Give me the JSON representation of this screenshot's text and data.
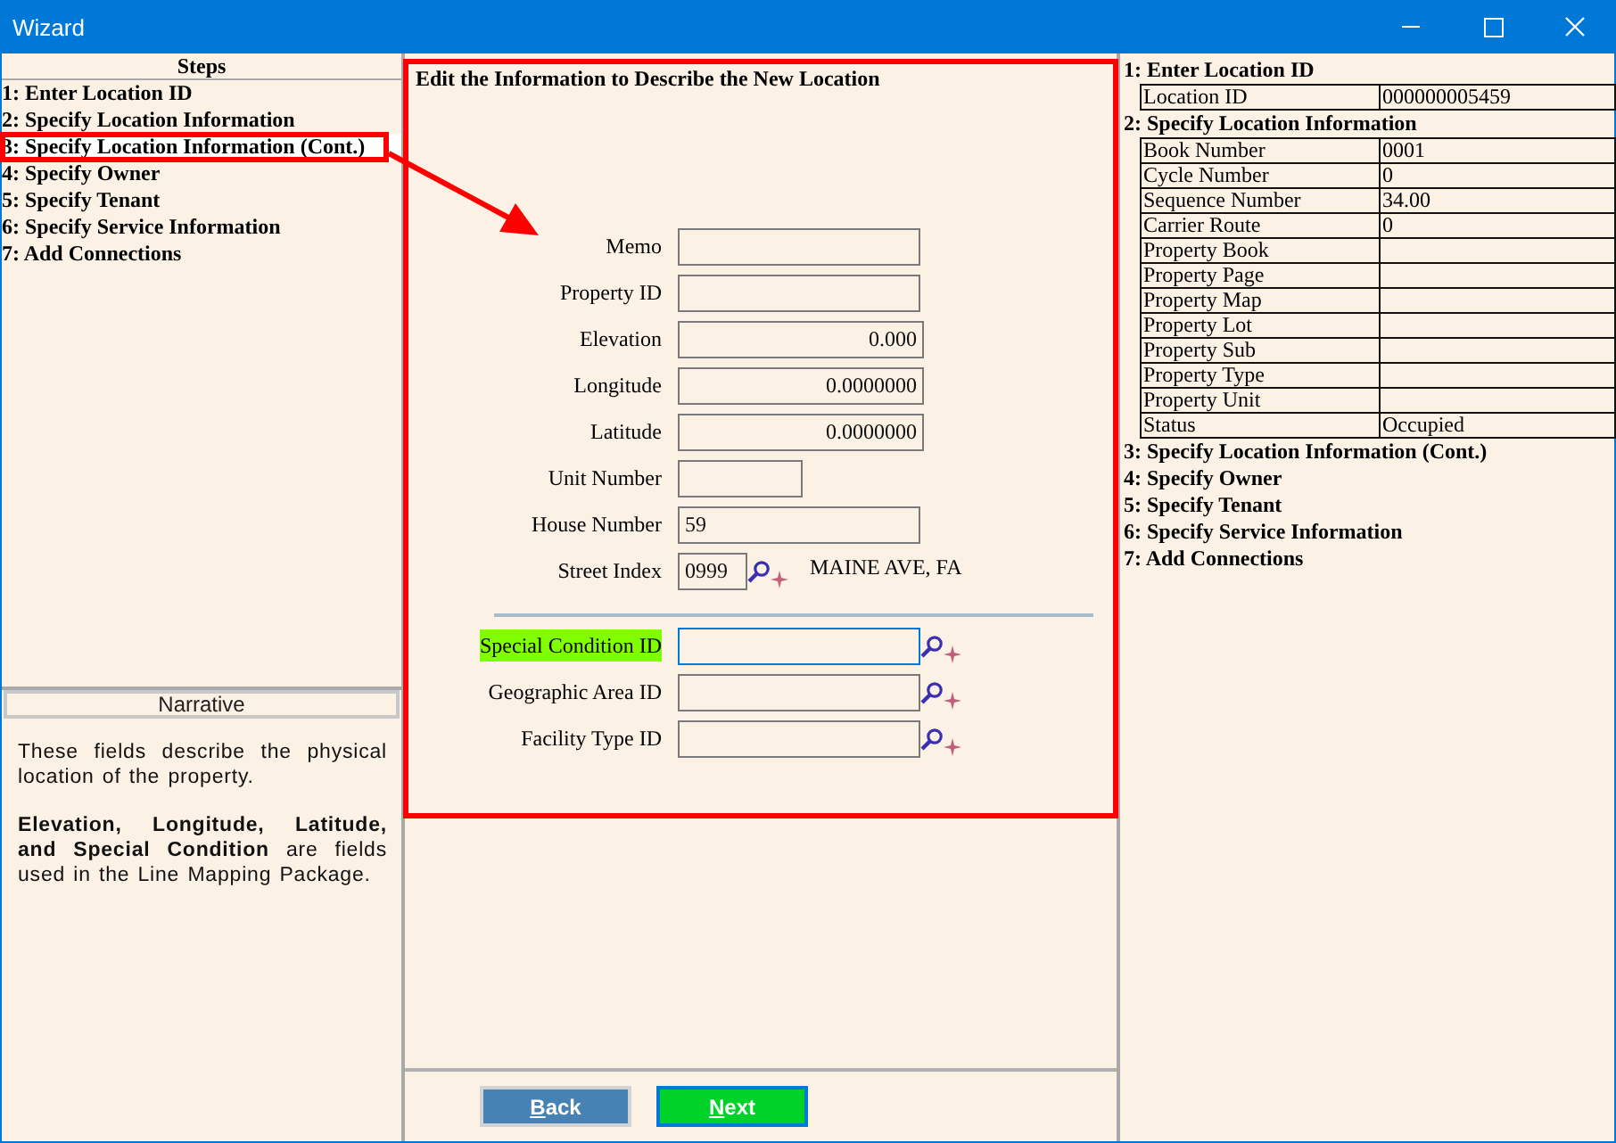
{
  "window": {
    "title": "Wizard"
  },
  "steps": {
    "title": "Steps",
    "items": [
      {
        "label": "1: Enter Location ID",
        "selected": false
      },
      {
        "label": "2: Specify Location Information",
        "selected": false
      },
      {
        "label": "3: Specify Location Information (Cont.)",
        "selected": true
      },
      {
        "label": "4: Specify Owner",
        "selected": false
      },
      {
        "label": "5: Specify Tenant",
        "selected": false
      },
      {
        "label": "6: Specify Service Information",
        "selected": false
      },
      {
        "label": "7: Add Connections",
        "selected": false
      }
    ]
  },
  "narrative": {
    "title": "Narrative",
    "paragraphs": [
      "These fields describe the physical location of the property.",
      "**Elevation, Longitude, Latitude, and Special Condition** are fields used in the Line Mapping Package."
    ]
  },
  "form": {
    "heading": "Edit the Information to Describe the New Location",
    "fields": [
      {
        "kind": "text",
        "label": "Memo"
      },
      {
        "kind": "text",
        "label": "Property ID"
      },
      {
        "kind": "number",
        "label": "Elevation",
        "value": "0.000"
      },
      {
        "kind": "number",
        "label": "Longitude",
        "value": "0.0000000"
      },
      {
        "kind": "number",
        "label": "Latitude",
        "value": "0.0000000"
      },
      {
        "kind": "short",
        "label": "Unit Number"
      },
      {
        "kind": "text",
        "label": "House Number",
        "value": "59"
      },
      {
        "kind": "street",
        "label": "Street Index",
        "value": "0999",
        "description": "MAINE AVE, FA"
      }
    ],
    "lookups": [
      {
        "label": "Special Condition ID",
        "highlighted": true,
        "focused": true
      },
      {
        "label": "Geographic Area ID",
        "highlighted": false,
        "focused": false
      },
      {
        "label": "Facility Type ID",
        "highlighted": false,
        "focused": false
      }
    ]
  },
  "buttons": [
    {
      "label": "Back",
      "kind": "back"
    },
    {
      "label": "Next",
      "kind": "next"
    }
  ],
  "summary": {
    "sections": [
      {
        "title": "1: Enter Location ID",
        "rows": [
          {
            "label": "Location ID",
            "value": "000000005459"
          }
        ]
      },
      {
        "title": "2: Specify Location Information",
        "rows": [
          {
            "label": "Book Number",
            "value": "0001"
          },
          {
            "label": "Cycle Number",
            "value": "0"
          },
          {
            "label": "Sequence Number",
            "value": "34.00"
          },
          {
            "label": "Carrier Route",
            "value": "0"
          },
          {
            "label": "Property Book"
          },
          {
            "label": "Property Page"
          },
          {
            "label": "Property Map"
          },
          {
            "label": "Property Lot"
          },
          {
            "label": "Property Sub"
          },
          {
            "label": "Property Type"
          },
          {
            "label": "Property Unit"
          },
          {
            "label": "Status",
            "value": "Occupied"
          }
        ]
      },
      {
        "title": "3: Specify Location Information (Cont.)"
      },
      {
        "title": "4: Specify Owner"
      },
      {
        "title": "5: Specify Tenant"
      },
      {
        "title": "6: Specify Service Information"
      },
      {
        "title": "7: Add Connections"
      }
    ]
  }
}
